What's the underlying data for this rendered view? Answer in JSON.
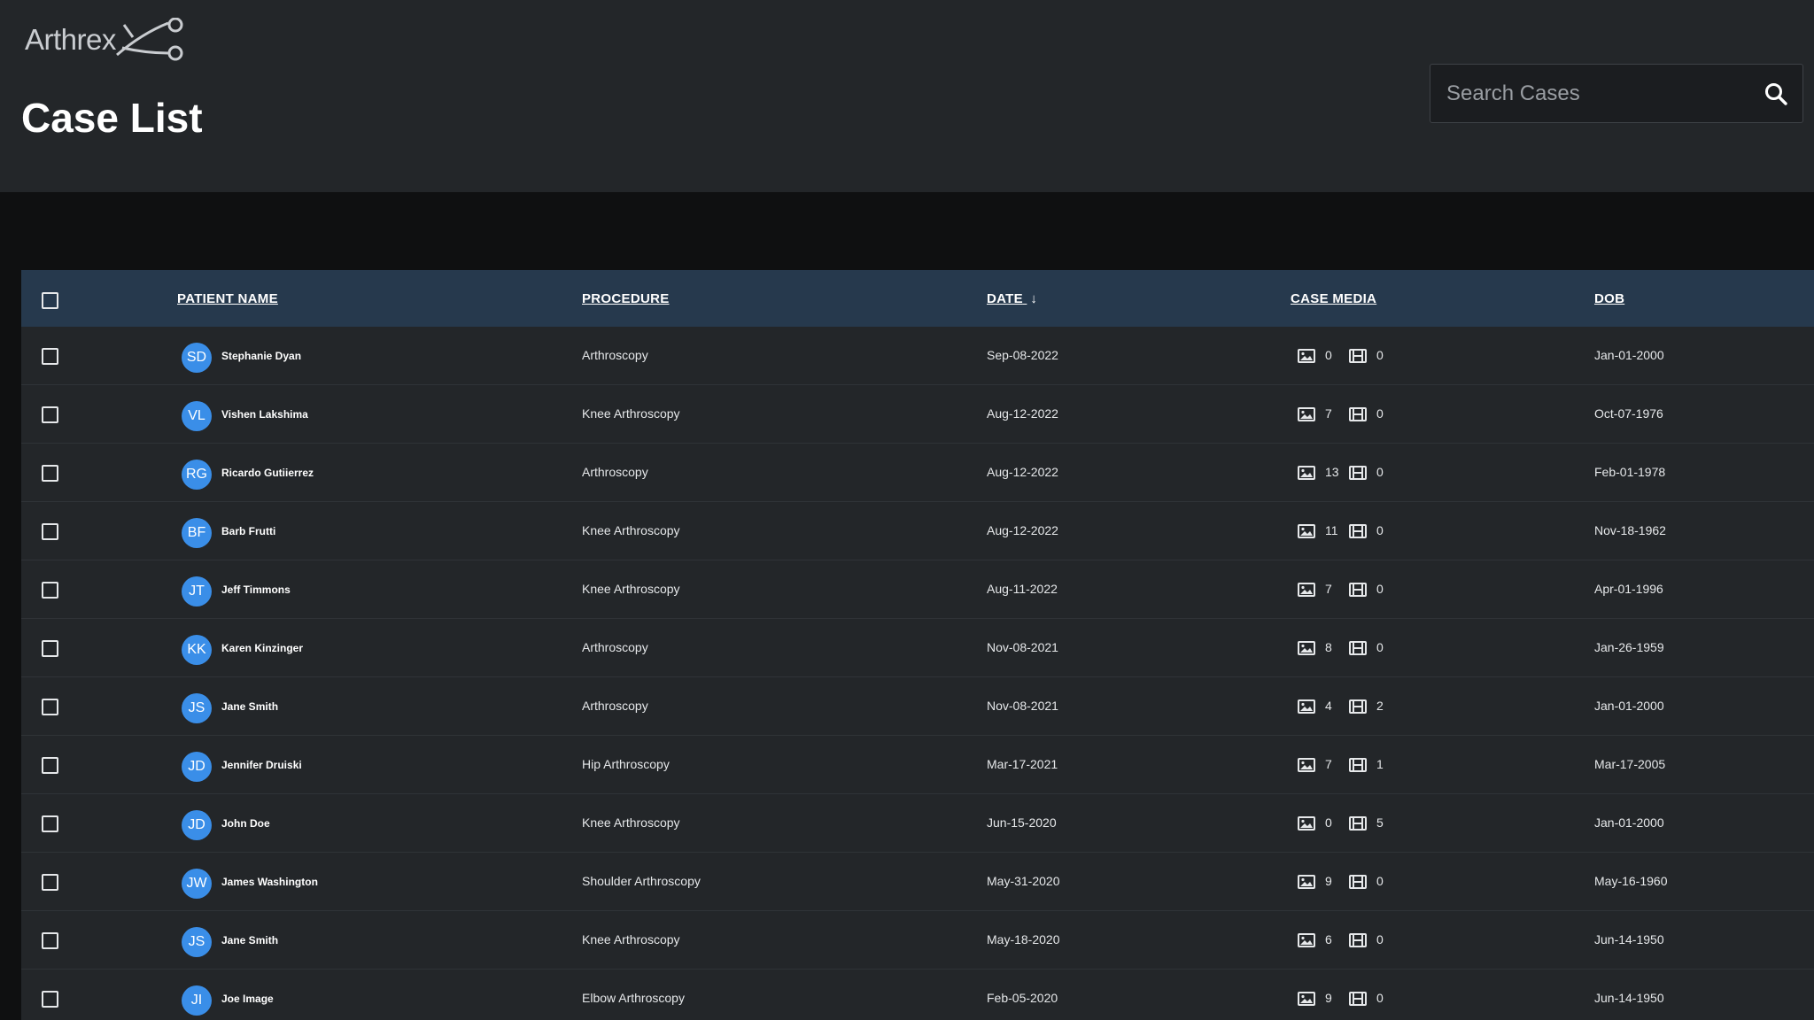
{
  "brand": {
    "logo_text": "Arthrex"
  },
  "page": {
    "title": "Case List"
  },
  "search": {
    "placeholder": "Search Cases",
    "value": ""
  },
  "table": {
    "columns": {
      "patient_name": "PATIENT NAME",
      "procedure": "PROCEDURE",
      "date": "DATE",
      "case_media": "CASE MEDIA",
      "dob": "DOB"
    },
    "sort_indicator": "↓",
    "rows": [
      {
        "initials": "SD",
        "name": "Stephanie Dyan",
        "procedure": "Arthroscopy",
        "date": "Sep-08-2022",
        "images": "0",
        "videos": "0",
        "dob": "Jan-01-2000"
      },
      {
        "initials": "VL",
        "name": "Vishen Lakshima",
        "procedure": "Knee Arthroscopy",
        "date": "Aug-12-2022",
        "images": "7",
        "videos": "0",
        "dob": "Oct-07-1976"
      },
      {
        "initials": "RG",
        "name": "Ricardo Gutiierrez",
        "procedure": "Arthroscopy",
        "date": "Aug-12-2022",
        "images": "13",
        "videos": "0",
        "dob": "Feb-01-1978"
      },
      {
        "initials": "BF",
        "name": "Barb Frutti",
        "procedure": "Knee Arthroscopy",
        "date": "Aug-12-2022",
        "images": "11",
        "videos": "0",
        "dob": "Nov-18-1962"
      },
      {
        "initials": "JT",
        "name": "Jeff Timmons",
        "procedure": "Knee Arthroscopy",
        "date": "Aug-11-2022",
        "images": "7",
        "videos": "0",
        "dob": "Apr-01-1996"
      },
      {
        "initials": "KK",
        "name": "Karen Kinzinger",
        "procedure": "Arthroscopy",
        "date": "Nov-08-2021",
        "images": "8",
        "videos": "0",
        "dob": "Jan-26-1959"
      },
      {
        "initials": "JS",
        "name": "Jane Smith",
        "procedure": "Arthroscopy",
        "date": "Nov-08-2021",
        "images": "4",
        "videos": "2",
        "dob": "Jan-01-2000"
      },
      {
        "initials": "JD",
        "name": "Jennifer Druiski",
        "procedure": "Hip Arthroscopy",
        "date": "Mar-17-2021",
        "images": "7",
        "videos": "1",
        "dob": "Mar-17-2005"
      },
      {
        "initials": "JD",
        "name": "John Doe",
        "procedure": "Knee Arthroscopy",
        "date": "Jun-15-2020",
        "images": "0",
        "videos": "5",
        "dob": "Jan-01-2000"
      },
      {
        "initials": "JW",
        "name": "James Washington",
        "procedure": "Shoulder Arthroscopy",
        "date": "May-31-2020",
        "images": "9",
        "videos": "0",
        "dob": "May-16-1960"
      },
      {
        "initials": "JS",
        "name": "Jane Smith",
        "procedure": "Knee Arthroscopy",
        "date": "May-18-2020",
        "images": "6",
        "videos": "0",
        "dob": "Jun-14-1950"
      },
      {
        "initials": "JI",
        "name": "Joe Image",
        "procedure": "Elbow Arthroscopy",
        "date": "Feb-05-2020",
        "images": "9",
        "videos": "0",
        "dob": "Jun-14-1950"
      }
    ]
  },
  "colors": {
    "header_bg": "#232629",
    "table_header_bg": "#26394d",
    "avatar_blue": "#3a8ee8",
    "page_bg": "#0f1011"
  },
  "icons": {
    "search": "search-icon",
    "images": "image-icon",
    "videos": "film-icon"
  }
}
